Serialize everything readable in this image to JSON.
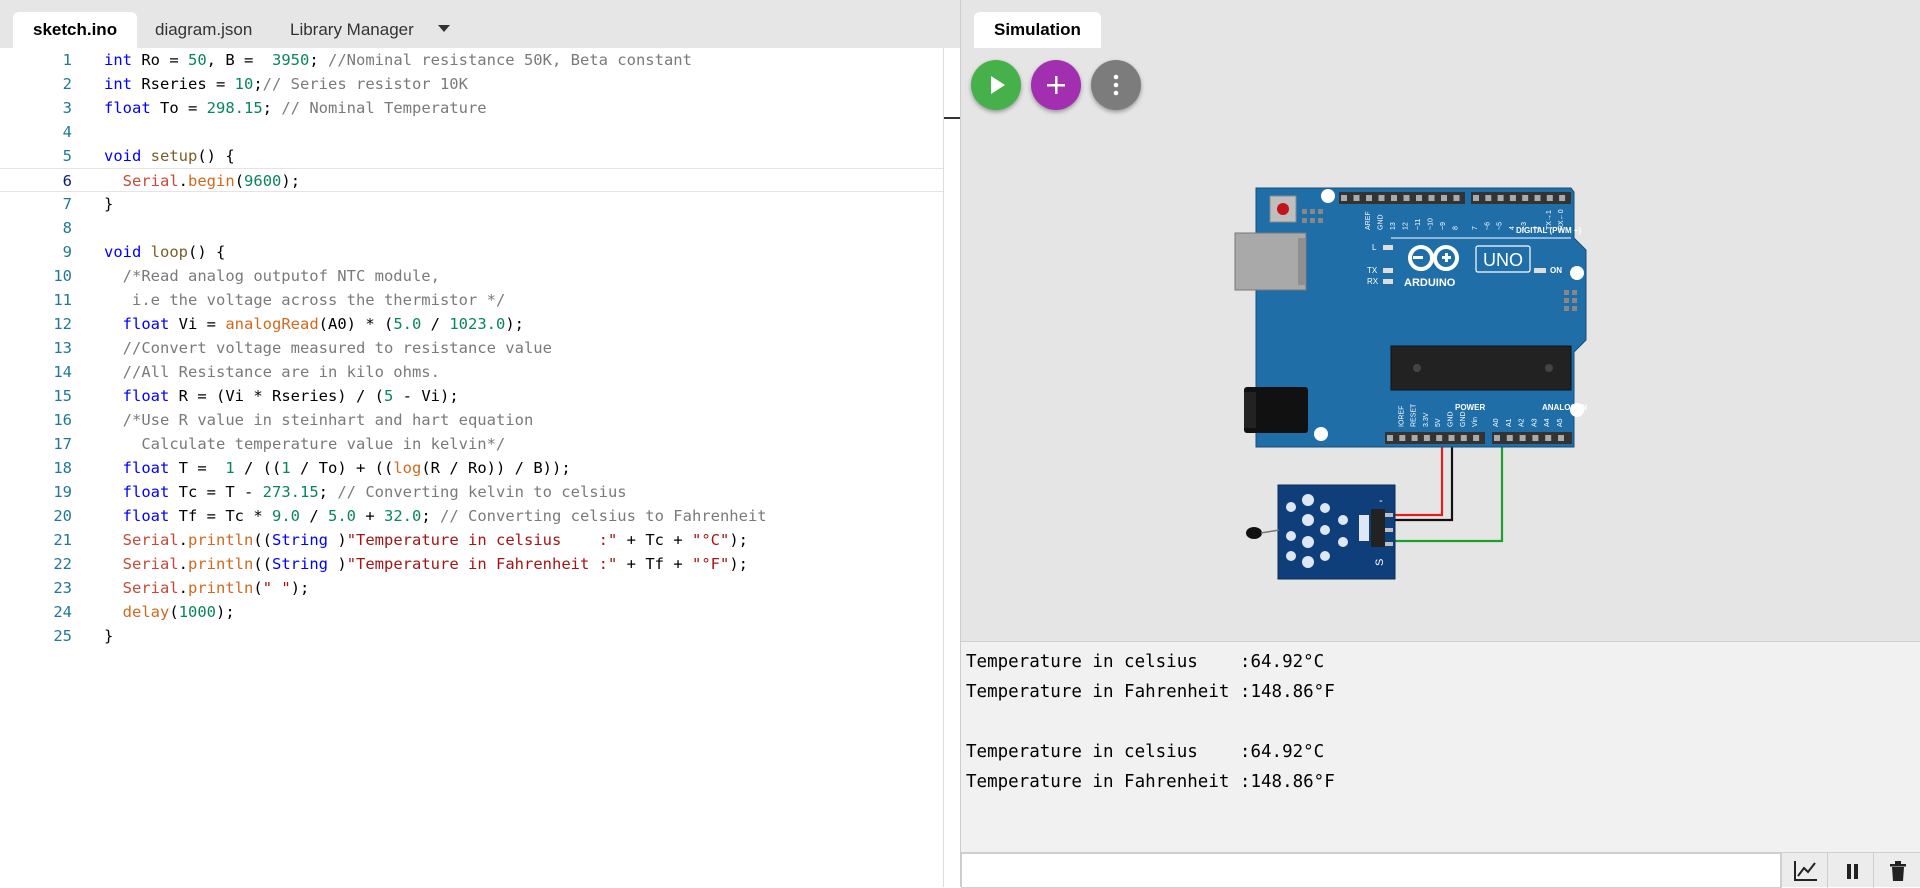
{
  "editor": {
    "tabs": [
      {
        "label": "sketch.ino"
      },
      {
        "label": "diagram.json"
      },
      {
        "label": "Library Manager"
      }
    ],
    "current_line": 6,
    "lines": [
      [
        [
          "ty",
          "int"
        ],
        [
          "",
          "Ro = "
        ],
        [
          "num",
          "50"
        ],
        [
          "",
          ", B =  "
        ],
        [
          "num",
          "3950"
        ],
        [
          "",
          "; "
        ],
        [
          "cm",
          "//Nominal resistance 50K, Beta constant"
        ]
      ],
      [
        [
          "ty",
          "int"
        ],
        [
          "",
          "Rseries = "
        ],
        [
          "num",
          "10"
        ],
        [
          "",
          ";"
        ],
        [
          "cm",
          "// Series resistor 10K"
        ]
      ],
      [
        [
          "ty",
          "float"
        ],
        [
          "",
          "To = "
        ],
        [
          "num",
          "298.15"
        ],
        [
          "",
          "; "
        ],
        [
          "cm",
          "// Nominal Temperature"
        ]
      ],
      [],
      [
        [
          "ty",
          "void"
        ],
        [
          "",
          ""
        ],
        [
          "fnd",
          "setup"
        ],
        [
          "",
          "() {"
        ]
      ],
      [
        [
          "",
          "  "
        ],
        [
          "cls",
          "Serial"
        ],
        [
          "",
          "."
        ],
        [
          "fn",
          "begin"
        ],
        [
          "",
          "("
        ],
        [
          "num",
          "9600"
        ],
        [
          "",
          ");"
        ]
      ],
      [
        [
          "",
          "}"
        ]
      ],
      [],
      [
        [
          "ty",
          "void"
        ],
        [
          "",
          ""
        ],
        [
          "fnd",
          "loop"
        ],
        [
          "",
          "() {"
        ]
      ],
      [
        [
          "",
          "  "
        ],
        [
          "cm",
          "/*Read analog outputof NTC module,"
        ]
      ],
      [
        [
          "",
          "   "
        ],
        [
          "cm",
          "i.e the voltage across the thermistor */"
        ]
      ],
      [
        [
          "",
          "  "
        ],
        [
          "ty",
          "float"
        ],
        [
          "",
          "Vi = "
        ],
        [
          "fn",
          "analogRead"
        ],
        [
          "",
          "(A0) * ("
        ],
        [
          "num",
          "5.0"
        ],
        [
          "",
          " / "
        ],
        [
          "num",
          "1023.0"
        ],
        [
          "",
          ");"
        ]
      ],
      [
        [
          "",
          "  "
        ],
        [
          "cm",
          "//Convert voltage measured to resistance value"
        ]
      ],
      [
        [
          "",
          "  "
        ],
        [
          "cm",
          "//All Resistance are in kilo ohms."
        ]
      ],
      [
        [
          "",
          "  "
        ],
        [
          "ty",
          "float"
        ],
        [
          "",
          "R = (Vi * Rseries) / ("
        ],
        [
          "num",
          "5"
        ],
        [
          "",
          ""
        ],
        [
          "",
          ""
        ],
        [
          "",
          ""
        ],
        [
          "",
          "- Vi);"
        ]
      ],
      [
        [
          "",
          "  "
        ],
        [
          "cm",
          "/*Use R value in steinhart and hart equation"
        ]
      ],
      [
        [
          "",
          "    "
        ],
        [
          "cm",
          "Calculate temperature value in kelvin*/"
        ]
      ],
      [
        [
          "",
          "  "
        ],
        [
          "ty",
          "float"
        ],
        [
          "",
          "T =  "
        ],
        [
          "num",
          "1"
        ],
        [
          "",
          ""
        ],
        [
          "",
          ""
        ],
        [
          "",
          ""
        ],
        [
          "",
          "/ (("
        ],
        [
          "num",
          "1"
        ],
        [
          "",
          ""
        ],
        [
          "",
          "/ To) + (("
        ],
        [
          "fn",
          "log"
        ],
        [
          "",
          "(R / Ro)) / B));"
        ]
      ],
      [
        [
          "",
          "  "
        ],
        [
          "ty",
          "float"
        ],
        [
          "",
          "Tc = T - "
        ],
        [
          "num",
          "273.15"
        ],
        [
          "",
          "; "
        ],
        [
          "cm",
          "// Converting kelvin to celsius"
        ]
      ],
      [
        [
          "",
          "  "
        ],
        [
          "ty",
          "float"
        ],
        [
          "",
          "Tf = Tc * "
        ],
        [
          "num",
          "9.0"
        ],
        [
          "",
          ""
        ],
        [
          "",
          ""
        ],
        [
          "",
          "/ "
        ],
        [
          "num",
          "5.0"
        ],
        [
          "",
          ""
        ],
        [
          "",
          "+ "
        ],
        [
          "num",
          "32.0"
        ],
        [
          "",
          "; "
        ],
        [
          "cm",
          "// Converting celsius to Fahrenheit"
        ]
      ],
      [
        [
          "",
          "  "
        ],
        [
          "cls",
          "Serial"
        ],
        [
          "",
          "."
        ],
        [
          "fn",
          "println"
        ],
        [
          "",
          "(("
        ],
        [
          "ty",
          "String"
        ],
        [
          "",
          ")"
        ],
        [
          "str",
          "\"Temperature in celsius    :\""
        ],
        [
          "",
          ""
        ],
        [
          "",
          "+ Tc + "
        ],
        [
          "str",
          "\"°C\""
        ],
        [
          "",
          ");"
        ]
      ],
      [
        [
          "",
          "  "
        ],
        [
          "cls",
          "Serial"
        ],
        [
          "",
          "."
        ],
        [
          "fn",
          "println"
        ],
        [
          "",
          "(("
        ],
        [
          "ty",
          "String"
        ],
        [
          "",
          ")"
        ],
        [
          "str",
          "\"Temperature in Fahrenheit :\""
        ],
        [
          "",
          ""
        ],
        [
          "",
          "+ Tf + "
        ],
        [
          "str",
          "\"°F\""
        ],
        [
          "",
          ");"
        ]
      ],
      [
        [
          "",
          "  "
        ],
        [
          "cls",
          "Serial"
        ],
        [
          "",
          "."
        ],
        [
          "fn",
          "println"
        ],
        [
          "",
          "("
        ],
        [
          "str",
          "\" \""
        ],
        [
          "",
          ");"
        ]
      ],
      [
        [
          "",
          "  "
        ],
        [
          "fn",
          "delay"
        ],
        [
          "",
          "("
        ],
        [
          "num",
          "1000"
        ],
        [
          "",
          ");"
        ]
      ],
      [
        [
          "",
          "}"
        ]
      ]
    ]
  },
  "simulation": {
    "tab_label": "Simulation",
    "buttons": {
      "play": "play-icon",
      "add": "plus-icon",
      "more": "more-vertical-icon"
    },
    "board": {
      "brand": "ARDUINO",
      "model": "UNO",
      "digital_label": "DIGITAL (PWM ~)",
      "analog_label": "ANALOG IN",
      "power_label": "POWER",
      "on_label": "ON",
      "tx_label": "TX",
      "rx_label": "RX",
      "l_label": "L",
      "digital_pins": [
        "AREF",
        "GND",
        "13",
        "12",
        "~11",
        "~10",
        "~9",
        "8",
        "7",
        "~6",
        "~5",
        "4",
        "~3",
        "2",
        "TX→1",
        "RX←0"
      ],
      "power_pins": [
        "IOREF",
        "RESET",
        "3.3V",
        "5V",
        "GND",
        "GND",
        "Vin"
      ],
      "analog_pins": [
        "A0",
        "A1",
        "A2",
        "A3",
        "A4",
        "A5"
      ]
    },
    "sensor": {
      "pin_label": "S",
      "minus_label": "-"
    },
    "serial_output": [
      "Temperature in celsius    :64.92°C",
      "Temperature in Fahrenheit :148.86°F",
      "",
      "Temperature in celsius    :64.92°C",
      "Temperature in Fahrenheit :148.86°F"
    ],
    "serial_input_value": "",
    "footer_buttons": [
      "chart-icon",
      "pause-icon",
      "trash-icon"
    ],
    "colors": {
      "play": "#46b14a",
      "add": "#a22faf",
      "more": "#7c7c7c",
      "board": "#1f6ea8",
      "wire_red": "#e02020",
      "wire_green": "#1e9e2a"
    }
  }
}
